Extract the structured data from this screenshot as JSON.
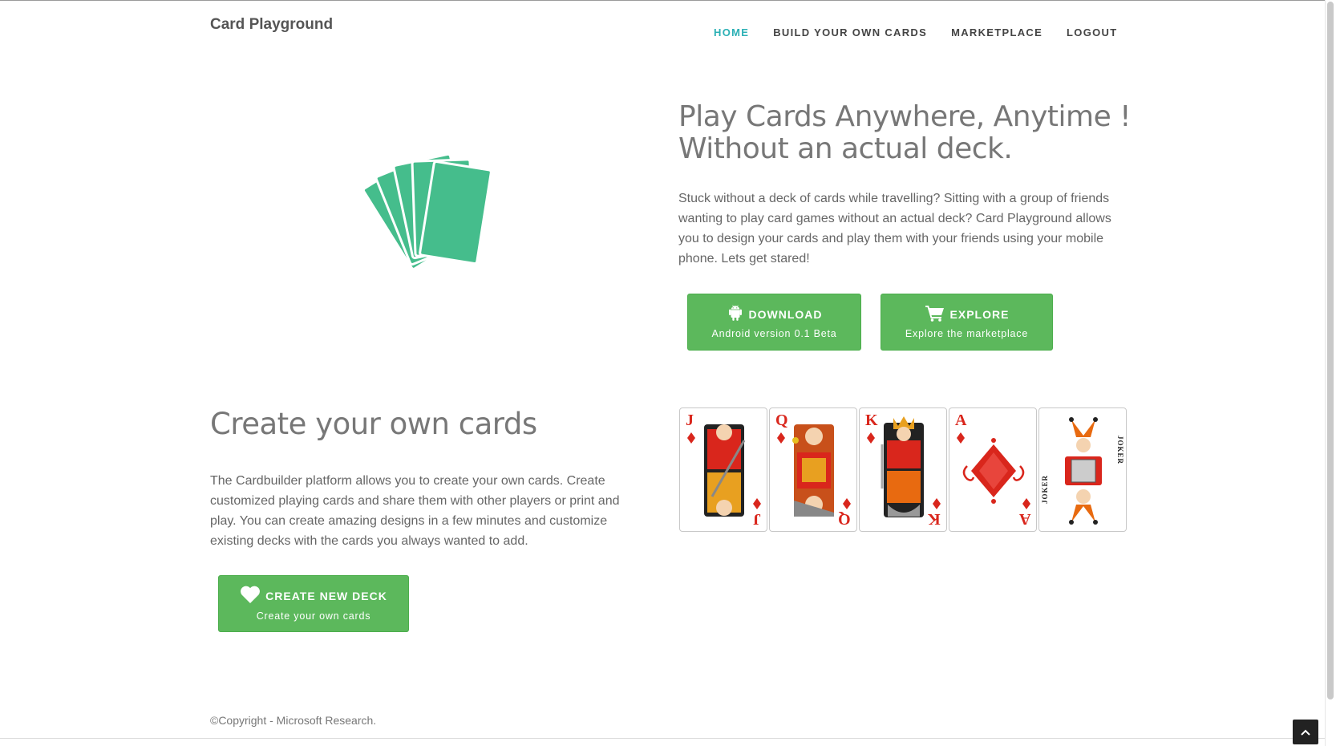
{
  "brand": "Card Playground",
  "nav": [
    {
      "label": "HOME",
      "active": true
    },
    {
      "label": "BUILD YOUR OWN CARDS",
      "active": false
    },
    {
      "label": "MARKETPLACE",
      "active": false
    },
    {
      "label": "LOGOUT",
      "active": false
    }
  ],
  "hero": {
    "title_line1": "Play Cards Anywhere, Anytime !",
    "title_line2": "Without an actual deck.",
    "text": "Stuck without a deck of cards while travelling? Sitting with a group of friends wanting to play card games without an actual deck? Card Playground allows you to design your cards and play them with your friends using your mobile phone. Lets get stared!",
    "download_title": "DOWNLOAD",
    "download_sub": "Android version 0.1 Beta",
    "explore_title": "EXPLORE",
    "explore_sub": "Explore the marketplace"
  },
  "create": {
    "title": "Create your own cards",
    "text": "The Cardbuilder platform allows you to create your own cards. Create customized playing cards and share them with other players or print and play. You can create amazing designs in a few minutes and customize existing decks with the cards you always wanted to add.",
    "button_title": "CREATE NEW DECK",
    "button_sub": "Create your own cards"
  },
  "cards": [
    {
      "rank": "J"
    },
    {
      "rank": "Q"
    },
    {
      "rank": "K"
    },
    {
      "rank": "A"
    },
    {
      "rank": "JOKER"
    }
  ],
  "footer": "©Copyright - Microsoft Research.",
  "colors": {
    "accent": "#2bb0b5",
    "button": "#5cb85c",
    "fan_cards": "#45bd8c",
    "card_red": "#d9261c"
  }
}
